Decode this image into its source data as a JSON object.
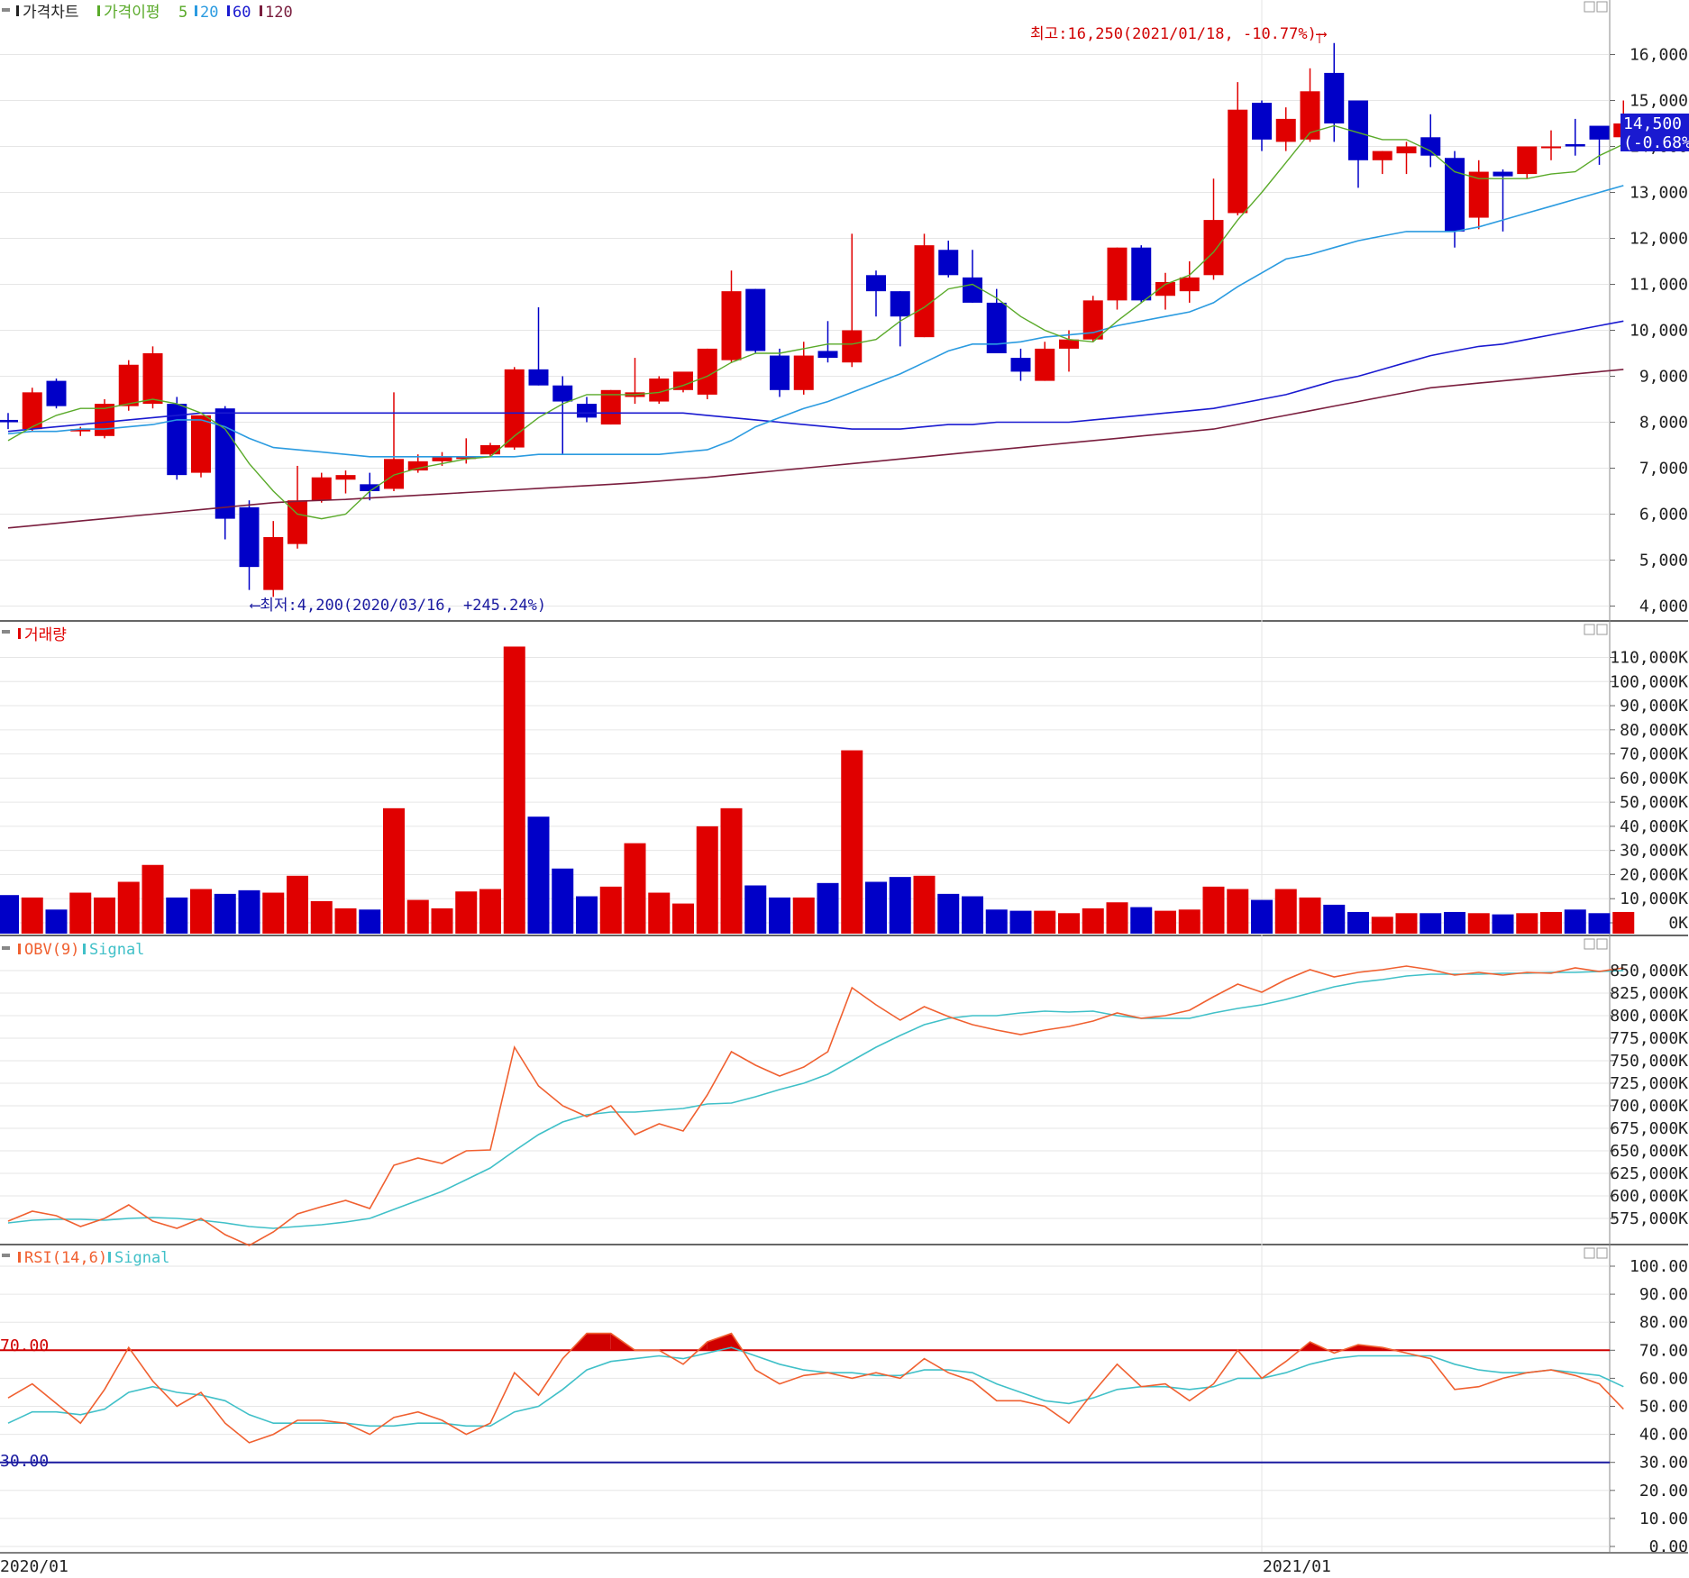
{
  "panels": {
    "price": {
      "label": "가격차트",
      "ma_label": "가격이평",
      "ma_periods": [
        "5",
        "20",
        "60",
        "120"
      ],
      "ma_colors": [
        "#5aaa2a",
        "#2b9be0",
        "#1a1ad0",
        "#7a1e3e"
      ],
      "high_annotation": "최고:16,250(2021/01/18, -10.77%)⟶",
      "low_annotation": "⟵최저:4,200(2020/03/16, +245.24%)",
      "current_value": "14,500",
      "current_change": "(-0.68%)"
    },
    "volume": {
      "label": "거래량"
    },
    "obv": {
      "label": "OBV(9)",
      "signal_label": "Signal"
    },
    "rsi": {
      "label": "RSI(14,6)",
      "signal_label": "Signal",
      "upper_label": "70.00",
      "lower_label": "30.00"
    }
  },
  "x_labels": [
    "2020/01",
    "2021/01"
  ],
  "colors": {
    "up": "#e00000",
    "down": "#0000c8",
    "obv": "#f06030",
    "signal": "#40c0c8",
    "rsi_hi": "#d00000",
    "rsi_lo": "#1a1aa0"
  },
  "chart_data": [
    {
      "type": "candlestick",
      "y_ticks": [
        "4,000",
        "5,000",
        "6,000",
        "7,000",
        "8,000",
        "9,000",
        "10,000",
        "11,000",
        "12,000",
        "13,000",
        "14,000",
        "15,000",
        "16,000"
      ],
      "ylim": [
        3800,
        16600
      ],
      "candles": [
        [
          8050,
          8200,
          7850,
          8000
        ],
        [
          7850,
          8750,
          7800,
          8650
        ],
        [
          8900,
          8950,
          8300,
          8350
        ],
        [
          7800,
          7900,
          7700,
          7850
        ],
        [
          7700,
          8500,
          7650,
          8400
        ],
        [
          8350,
          9350,
          8250,
          9250
        ],
        [
          8400,
          9650,
          8300,
          9500
        ],
        [
          8400,
          8550,
          6750,
          6850
        ],
        [
          6900,
          8150,
          6800,
          8150
        ],
        [
          8300,
          8350,
          5450,
          5900
        ],
        [
          6150,
          6300,
          4350,
          4850
        ],
        [
          4350,
          5850,
          4200,
          5500
        ],
        [
          5350,
          7050,
          5250,
          6300
        ],
        [
          6300,
          6900,
          6250,
          6800
        ],
        [
          6750,
          6950,
          6450,
          6850
        ],
        [
          6650,
          6900,
          6300,
          6500
        ],
        [
          6550,
          8650,
          6500,
          7200
        ],
        [
          6950,
          7300,
          6900,
          7150
        ],
        [
          7150,
          7350,
          7050,
          7250
        ],
        [
          7200,
          7650,
          7100,
          7250
        ],
        [
          7300,
          7550,
          7250,
          7500
        ],
        [
          7450,
          9200,
          7400,
          9150
        ],
        [
          9150,
          10500,
          8800,
          8800
        ],
        [
          8800,
          9000,
          7300,
          8450
        ],
        [
          8400,
          8550,
          8000,
          8100
        ],
        [
          7950,
          8700,
          7950,
          8700
        ],
        [
          8550,
          9400,
          8400,
          8650
        ],
        [
          8450,
          9000,
          8400,
          8950
        ],
        [
          8700,
          9050,
          8650,
          9100
        ],
        [
          8600,
          9600,
          8500,
          9600
        ],
        [
          9350,
          11300,
          9300,
          10850
        ],
        [
          10900,
          10900,
          9500,
          9550
        ],
        [
          9450,
          9600,
          8550,
          8700
        ],
        [
          8700,
          9750,
          8600,
          9450
        ],
        [
          9550,
          10200,
          9300,
          9400
        ],
        [
          9300,
          12100,
          9200,
          10000
        ],
        [
          11200,
          11300,
          10300,
          10850
        ],
        [
          10850,
          10850,
          9650,
          10300
        ],
        [
          9850,
          12100,
          9850,
          11850
        ],
        [
          11750,
          11950,
          11150,
          11200
        ],
        [
          11150,
          11750,
          10600,
          10600
        ],
        [
          10600,
          10900,
          9550,
          9500
        ],
        [
          9400,
          9600,
          8900,
          9100
        ],
        [
          8900,
          9750,
          8900,
          9600
        ],
        [
          9600,
          10000,
          9100,
          9800
        ],
        [
          9800,
          10750,
          9750,
          10650
        ],
        [
          10650,
          11800,
          10450,
          11800
        ],
        [
          11800,
          11850,
          10600,
          10650
        ],
        [
          10750,
          11250,
          10450,
          11050
        ],
        [
          10850,
          11500,
          10600,
          11150
        ],
        [
          11200,
          13300,
          11100,
          12400
        ],
        [
          12550,
          15400,
          12500,
          14800
        ],
        [
          14950,
          15000,
          13900,
          14150
        ],
        [
          14100,
          14850,
          13900,
          14600
        ],
        [
          14150,
          15700,
          14100,
          15200
        ],
        [
          15600,
          16250,
          14100,
          14500
        ],
        [
          15000,
          14950,
          13100,
          13700
        ],
        [
          13700,
          13900,
          13400,
          13900
        ],
        [
          13850,
          14100,
          13400,
          14000
        ],
        [
          14200,
          14700,
          13550,
          13800
        ],
        [
          13750,
          13900,
          11800,
          12150
        ],
        [
          12450,
          13700,
          12200,
          13450
        ],
        [
          13450,
          13500,
          12150,
          13350
        ],
        [
          13400,
          13750,
          13300,
          14000
        ],
        [
          14000,
          14350,
          13700,
          14000
        ],
        [
          14050,
          14600,
          13800,
          14000
        ],
        [
          14450,
          14350,
          13600,
          14150
        ],
        [
          14200,
          15000,
          13900,
          14500
        ]
      ],
      "ma5": [
        7600,
        7900,
        8150,
        8300,
        8300,
        8400,
        8500,
        8400,
        8200,
        7850,
        7100,
        6500,
        6000,
        5900,
        6000,
        6500,
        6850,
        7000,
        7100,
        7200,
        7250,
        7700,
        8100,
        8400,
        8600,
        8600,
        8600,
        8650,
        8800,
        9000,
        9300,
        9500,
        9500,
        9600,
        9700,
        9700,
        9800,
        10200,
        10500,
        10900,
        11000,
        10700,
        10300,
        10000,
        9800,
        9750,
        10200,
        10600,
        11000,
        11200,
        11700,
        12400,
        13000,
        13650,
        14300,
        14450,
        14300,
        14150,
        14150,
        13900,
        13450,
        13300,
        13300,
        13300,
        13400,
        13450,
        13800,
        14050
      ],
      "ma20": [
        7750,
        7800,
        7800,
        7850,
        7850,
        7900,
        7950,
        8050,
        8050,
        7900,
        7650,
        7450,
        7400,
        7350,
        7300,
        7250,
        7250,
        7250,
        7250,
        7250,
        7250,
        7250,
        7300,
        7300,
        7300,
        7300,
        7300,
        7300,
        7350,
        7400,
        7600,
        7900,
        8100,
        8300,
        8450,
        8650,
        8850,
        9050,
        9300,
        9550,
        9700,
        9700,
        9750,
        9850,
        9900,
        9950,
        10100,
        10200,
        10300,
        10400,
        10600,
        10950,
        11250,
        11550,
        11650,
        11800,
        11950,
        12050,
        12150,
        12150,
        12150,
        12250,
        12400,
        12550,
        12700,
        12850,
        13000,
        13150
      ],
      "ma60": [
        7800,
        7850,
        7900,
        7950,
        8000,
        8050,
        8100,
        8150,
        8200,
        8200,
        8200,
        8200,
        8200,
        8200,
        8200,
        8200,
        8200,
        8200,
        8200,
        8200,
        8200,
        8200,
        8200,
        8200,
        8200,
        8200,
        8200,
        8200,
        8200,
        8150,
        8100,
        8050,
        8000,
        7950,
        7900,
        7850,
        7850,
        7850,
        7900,
        7950,
        7950,
        8000,
        8000,
        8000,
        8000,
        8050,
        8100,
        8150,
        8200,
        8250,
        8300,
        8400,
        8500,
        8600,
        8750,
        8900,
        9000,
        9150,
        9300,
        9450,
        9550,
        9650,
        9700,
        9800,
        9900,
        10000,
        10100,
        10200
      ],
      "ma120": [
        5700,
        5750,
        5800,
        5850,
        5900,
        5950,
        6000,
        6050,
        6100,
        6150,
        6200,
        6250,
        6280,
        6300,
        6320,
        6350,
        6380,
        6410,
        6440,
        6470,
        6500,
        6530,
        6560,
        6590,
        6620,
        6650,
        6680,
        6720,
        6760,
        6800,
        6850,
        6900,
        6950,
        7000,
        7050,
        7100,
        7150,
        7200,
        7250,
        7300,
        7350,
        7400,
        7450,
        7500,
        7550,
        7600,
        7650,
        7700,
        7750,
        7800,
        7850,
        7950,
        8050,
        8150,
        8250,
        8350,
        8450,
        8550,
        8650,
        8750,
        8800,
        8850,
        8900,
        8950,
        9000,
        9050,
        9100,
        9150
      ]
    },
    {
      "type": "bar",
      "title": "거래량",
      "y_ticks": [
        "0K",
        "10,000K",
        "20,000K",
        "30,000K",
        "40,000K",
        "50,000K",
        "60,000K",
        "70,000K",
        "80,000K",
        "90,000K",
        "100,000K",
        "110,000K"
      ],
      "ylim": [
        0,
        115000
      ],
      "values": [
        11500,
        10500,
        5500,
        12500,
        10500,
        17000,
        24000,
        10500,
        14000,
        12000,
        13500,
        12500,
        19500,
        9000,
        6000,
        5500,
        47500,
        9500,
        6000,
        13000,
        14000,
        114500,
        44000,
        22500,
        11000,
        15000,
        33000,
        12500,
        8000,
        40000,
        47500,
        15500,
        10500,
        10500,
        16500,
        71500,
        17000,
        19000,
        19500,
        12000,
        11000,
        5500,
        5000,
        5000,
        4000,
        6000,
        8500,
        6500,
        5000,
        5500,
        15000,
        14000,
        9500,
        14000,
        10500,
        7500,
        4500,
        2500,
        4000,
        4000,
        4500,
        4000,
        3500,
        4000,
        4500,
        5500,
        4000,
        4500
      ]
    },
    {
      "type": "line",
      "title": "OBV(9)",
      "y_ticks": [
        "575,000K",
        "600,000K",
        "625,000K",
        "650,000K",
        "675,000K",
        "700,000K",
        "725,000K",
        "750,000K",
        "775,000K",
        "800,000K",
        "825,000K",
        "850,000K"
      ],
      "ylim": [
        562000,
        872000
      ],
      "series": [
        {
          "name": "OBV(9)",
          "values": [
            572000,
            583000,
            578000,
            566000,
            575000,
            590000,
            572000,
            564000,
            575000,
            557000,
            545000,
            560000,
            580000,
            588000,
            595000,
            586000,
            634000,
            642000,
            636000,
            650000,
            651000,
            765000,
            722000,
            700000,
            688000,
            700000,
            668000,
            680000,
            672000,
            712000,
            760000,
            745000,
            733000,
            743000,
            760000,
            831000,
            812000,
            795000,
            810000,
            799000,
            790000,
            784000,
            779000,
            784000,
            788000,
            794000,
            803000,
            797000,
            800000,
            806000,
            821000,
            835000,
            826000,
            840000,
            851000,
            843000,
            848000,
            851000,
            855000,
            851000,
            845000,
            848000,
            845000,
            848000,
            847000,
            853000,
            849000,
            853000
          ]
        },
        {
          "name": "Signal",
          "values": [
            570000,
            573000,
            574000,
            574000,
            573000,
            575000,
            576000,
            575000,
            573000,
            570000,
            566000,
            564000,
            566000,
            568000,
            571000,
            575000,
            585000,
            595000,
            605000,
            618000,
            631000,
            650000,
            668000,
            682000,
            690000,
            693000,
            693000,
            695000,
            697000,
            702000,
            703000,
            710000,
            718000,
            725000,
            735000,
            750000,
            765000,
            778000,
            790000,
            797000,
            800000,
            800000,
            803000,
            805000,
            804000,
            805000,
            800000,
            797000,
            797000,
            797000,
            803000,
            808000,
            812000,
            818000,
            825000,
            832000,
            837000,
            840000,
            844000,
            846000,
            846000,
            846000,
            847000,
            847000,
            848000,
            848000,
            849000,
            850000
          ]
        }
      ]
    },
    {
      "type": "line",
      "title": "RSI(14,6)",
      "y_ticks": [
        "0.00",
        "10.00",
        "20.00",
        "30.00",
        "40.00",
        "50.00",
        "60.00",
        "70.00",
        "80.00",
        "90.00",
        "100.00"
      ],
      "ylim": [
        0,
        103
      ],
      "series": [
        {
          "name": "RSI(14,6)",
          "values": [
            53,
            58,
            51,
            44,
            56,
            71,
            59,
            50,
            55,
            44,
            37,
            40,
            45,
            45,
            44,
            40,
            46,
            48,
            45,
            40,
            44,
            62,
            54,
            67,
            76,
            76,
            70,
            70,
            65,
            73,
            76,
            63,
            58,
            61,
            62,
            60,
            62,
            60,
            67,
            62,
            59,
            52,
            52,
            50,
            44,
            55,
            65,
            57,
            58,
            52,
            58,
            70,
            60,
            66,
            73,
            69,
            72,
            71,
            69,
            67,
            56,
            57,
            60,
            62,
            63,
            61,
            58,
            49
          ]
        },
        {
          "name": "Signal",
          "values": [
            44,
            48,
            48,
            47,
            49,
            55,
            57,
            55,
            54,
            52,
            47,
            44,
            44,
            44,
            44,
            43,
            43,
            44,
            44,
            43,
            43,
            48,
            50,
            56,
            63,
            66,
            67,
            68,
            67,
            69,
            71,
            68,
            65,
            63,
            62,
            62,
            61,
            61,
            63,
            63,
            62,
            58,
            55,
            52,
            51,
            53,
            56,
            57,
            57,
            56,
            57,
            60,
            60,
            62,
            65,
            67,
            68,
            68,
            68,
            68,
            65,
            63,
            62,
            62,
            63,
            62,
            61,
            57
          ]
        }
      ]
    }
  ]
}
